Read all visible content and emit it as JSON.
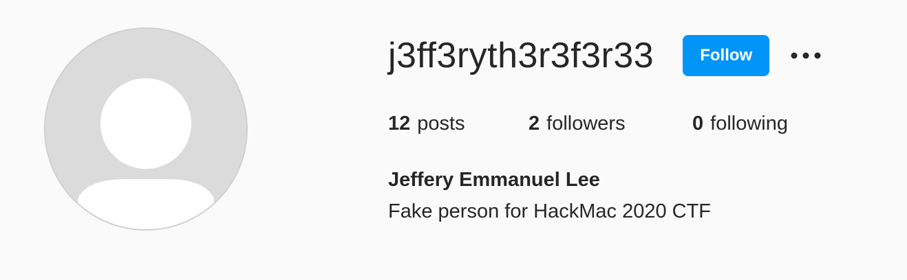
{
  "profile": {
    "username": "j3ff3ryth3r3f3r33",
    "full_name": "Jeffery Emmanuel Lee",
    "bio": "Fake person for HackMac 2020 CTF",
    "avatar_icon": "default-avatar-icon",
    "follow_label": "Follow",
    "more_icon": "more-options-icon"
  },
  "stats": {
    "posts": {
      "count": "12",
      "label": "posts"
    },
    "followers": {
      "count": "2",
      "label": "followers"
    },
    "following": {
      "count": "0",
      "label": "following"
    }
  },
  "colors": {
    "accent": "#0095f6",
    "background": "#fafafa",
    "text": "#262626",
    "avatar_bg": "#dbdbdb"
  }
}
